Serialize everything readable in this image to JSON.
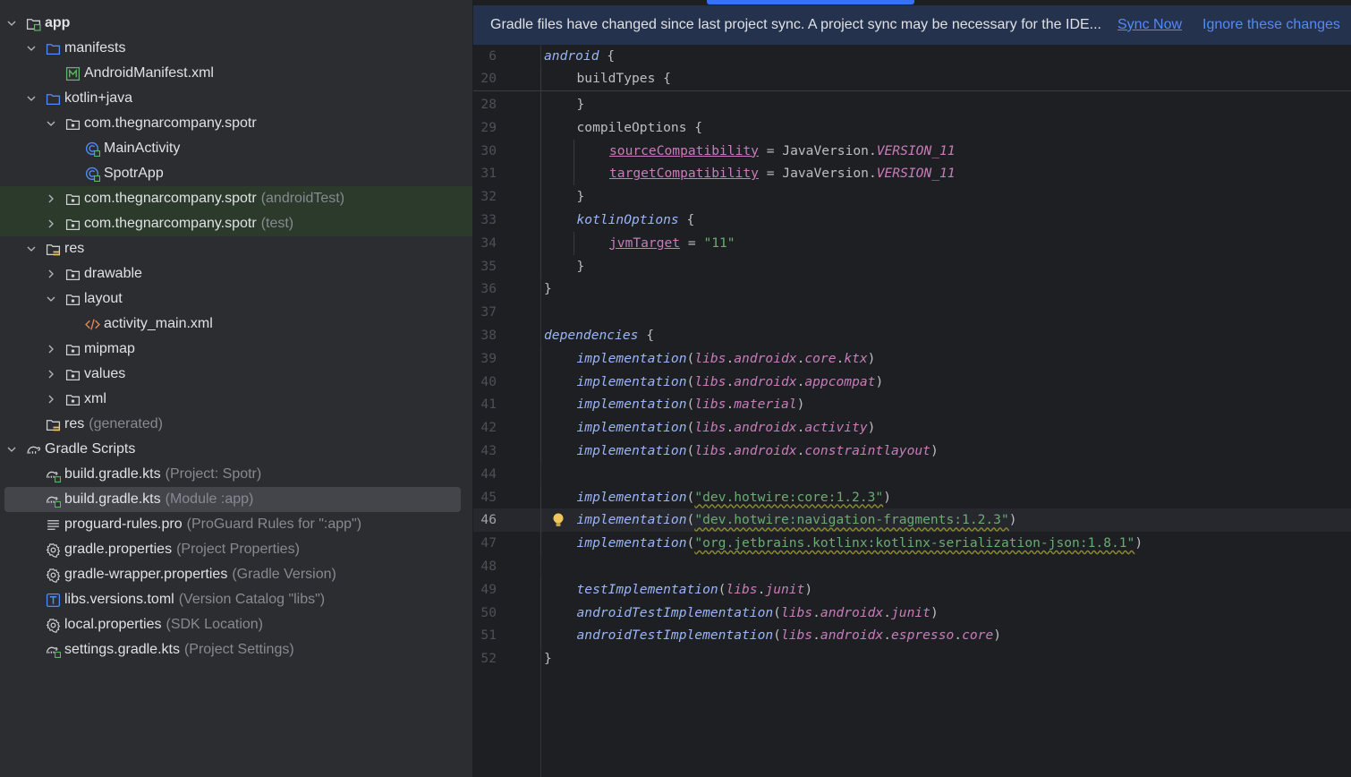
{
  "tree": [
    {
      "label": "app",
      "bold": true,
      "depth": 0,
      "chev": "down",
      "icon": "module-folder"
    },
    {
      "label": "manifests",
      "depth": 1,
      "chev": "down",
      "icon": "folder"
    },
    {
      "label": "AndroidManifest.xml",
      "depth": 2,
      "chev": "none",
      "icon": "manifest"
    },
    {
      "label": "kotlin+java",
      "depth": 1,
      "chev": "down",
      "icon": "folder"
    },
    {
      "label": "com.thegnarcompany.spotr",
      "depth": 2,
      "chev": "down",
      "icon": "package"
    },
    {
      "label": "MainActivity",
      "depth": 3,
      "chev": "none",
      "icon": "activity-class"
    },
    {
      "label": "SpotrApp",
      "depth": 3,
      "chev": "none",
      "icon": "activity-class"
    },
    {
      "label": "com.thegnarcompany.spotr",
      "hint": "(androidTest)",
      "depth": 2,
      "chev": "right",
      "icon": "package",
      "test": true
    },
    {
      "label": "com.thegnarcompany.spotr",
      "hint": "(test)",
      "depth": 2,
      "chev": "right",
      "icon": "package",
      "test": true
    },
    {
      "label": "res",
      "depth": 1,
      "chev": "down",
      "icon": "res-folder"
    },
    {
      "label": "drawable",
      "depth": 2,
      "chev": "right",
      "icon": "package"
    },
    {
      "label": "layout",
      "depth": 2,
      "chev": "down",
      "icon": "package"
    },
    {
      "label": "activity_main.xml",
      "depth": 3,
      "chev": "none",
      "icon": "xml"
    },
    {
      "label": "mipmap",
      "depth": 2,
      "chev": "right",
      "icon": "package"
    },
    {
      "label": "values",
      "depth": 2,
      "chev": "right",
      "icon": "package"
    },
    {
      "label": "xml",
      "depth": 2,
      "chev": "right",
      "icon": "package"
    },
    {
      "label": "res",
      "hint": "(generated)",
      "depth": 1,
      "chev": "none",
      "icon": "res-folder"
    },
    {
      "label": "Gradle Scripts",
      "depth": 0,
      "chev": "down",
      "icon": "gradle"
    },
    {
      "label": "build.gradle.kts",
      "hint": "(Project: Spotr)",
      "depth": 1,
      "chev": "none",
      "icon": "gradle-file"
    },
    {
      "label": "build.gradle.kts",
      "hint": "(Module :app)",
      "depth": 1,
      "chev": "none",
      "icon": "gradle-file",
      "selected": true
    },
    {
      "label": "proguard-rules.pro",
      "hint": "(ProGuard Rules for \":app\")",
      "depth": 1,
      "chev": "none",
      "icon": "text-file"
    },
    {
      "label": "gradle.properties",
      "hint": "(Project Properties)",
      "depth": 1,
      "chev": "none",
      "icon": "gear"
    },
    {
      "label": "gradle-wrapper.properties",
      "hint": "(Gradle Version)",
      "depth": 1,
      "chev": "none",
      "icon": "gear"
    },
    {
      "label": "libs.versions.toml",
      "hint": "(Version Catalog \"libs\")",
      "depth": 1,
      "chev": "none",
      "icon": "toml"
    },
    {
      "label": "local.properties",
      "hint": "(SDK Location)",
      "depth": 1,
      "chev": "none",
      "icon": "gear"
    },
    {
      "label": "settings.gradle.kts",
      "hint": "(Project Settings)",
      "depth": 1,
      "chev": "none",
      "icon": "gradle-file"
    }
  ],
  "banner": {
    "message": "Gradle files have changed since last project sync. A project sync may be necessary for the IDE...",
    "sync_now": "Sync Now",
    "ignore": "Ignore these changes"
  },
  "code": [
    {
      "n": "6",
      "t": [
        [
          "kw",
          "android"
        ],
        [
          "plain",
          " {"
        ]
      ]
    },
    {
      "n": "20",
      "i": 1,
      "t": [
        [
          "plain",
          "buildTypes {"
        ]
      ]
    },
    {
      "n": "28",
      "i": 1,
      "t": [
        [
          "plain",
          "}"
        ]
      ]
    },
    {
      "n": "29",
      "i": 1,
      "t": [
        [
          "plain",
          "compileOptions {"
        ]
      ]
    },
    {
      "n": "30",
      "i": 2,
      "t": [
        [
          "prop",
          "sourceCompatibility"
        ],
        [
          "plain",
          " = JavaVersion."
        ],
        [
          "pur",
          "VERSION_11"
        ]
      ]
    },
    {
      "n": "31",
      "i": 2,
      "t": [
        [
          "prop",
          "targetCompatibility"
        ],
        [
          "plain",
          " = JavaVersion."
        ],
        [
          "pur",
          "VERSION_11"
        ]
      ]
    },
    {
      "n": "32",
      "i": 1,
      "t": [
        [
          "plain",
          "}"
        ]
      ]
    },
    {
      "n": "33",
      "i": 1,
      "t": [
        [
          "kw",
          "kotlinOptions"
        ],
        [
          "plain",
          " {"
        ]
      ]
    },
    {
      "n": "34",
      "i": 2,
      "t": [
        [
          "prop",
          "jvmTarget"
        ],
        [
          "plain",
          " = "
        ],
        [
          "str",
          "\"11\""
        ]
      ]
    },
    {
      "n": "35",
      "i": 1,
      "t": [
        [
          "plain",
          "}"
        ]
      ]
    },
    {
      "n": "36",
      "t": [
        [
          "plain",
          "}"
        ]
      ]
    },
    {
      "n": "37",
      "t": []
    },
    {
      "n": "38",
      "t": [
        [
          "kw",
          "dependencies"
        ],
        [
          "plain",
          " {"
        ]
      ]
    },
    {
      "n": "39",
      "i": 1,
      "t": [
        [
          "kw",
          "implementation"
        ],
        [
          "plain",
          "("
        ],
        [
          "lib",
          "libs"
        ],
        [
          "plain",
          "."
        ],
        [
          "lib",
          "androidx"
        ],
        [
          "plain",
          "."
        ],
        [
          "lib",
          "core"
        ],
        [
          "plain",
          "."
        ],
        [
          "lib",
          "ktx"
        ],
        [
          "plain",
          ")"
        ]
      ]
    },
    {
      "n": "40",
      "i": 1,
      "t": [
        [
          "kw",
          "implementation"
        ],
        [
          "plain",
          "("
        ],
        [
          "lib",
          "libs"
        ],
        [
          "plain",
          "."
        ],
        [
          "lib",
          "androidx"
        ],
        [
          "plain",
          "."
        ],
        [
          "lib",
          "appcompat"
        ],
        [
          "plain",
          ")"
        ]
      ]
    },
    {
      "n": "41",
      "i": 1,
      "t": [
        [
          "kw",
          "implementation"
        ],
        [
          "plain",
          "("
        ],
        [
          "lib",
          "libs"
        ],
        [
          "plain",
          "."
        ],
        [
          "lib",
          "material"
        ],
        [
          "plain",
          ")"
        ]
      ]
    },
    {
      "n": "42",
      "i": 1,
      "t": [
        [
          "kw",
          "implementation"
        ],
        [
          "plain",
          "("
        ],
        [
          "lib",
          "libs"
        ],
        [
          "plain",
          "."
        ],
        [
          "lib",
          "androidx"
        ],
        [
          "plain",
          "."
        ],
        [
          "lib",
          "activity"
        ],
        [
          "plain",
          ")"
        ]
      ]
    },
    {
      "n": "43",
      "i": 1,
      "t": [
        [
          "kw",
          "implementation"
        ],
        [
          "plain",
          "("
        ],
        [
          "lib",
          "libs"
        ],
        [
          "plain",
          "."
        ],
        [
          "lib",
          "androidx"
        ],
        [
          "plain",
          "."
        ],
        [
          "lib",
          "constraintlayout"
        ],
        [
          "plain",
          ")"
        ]
      ]
    },
    {
      "n": "44",
      "t": []
    },
    {
      "n": "45",
      "i": 1,
      "t": [
        [
          "kw",
          "implementation"
        ],
        [
          "plain",
          "("
        ],
        [
          "strw",
          "\"dev.hotwire:core:1.2.3\""
        ],
        [
          "plain",
          ")"
        ]
      ]
    },
    {
      "n": "46",
      "i": 1,
      "cur": true,
      "bulb": true,
      "t": [
        [
          "kw",
          "implementation"
        ],
        [
          "plain",
          "("
        ],
        [
          "strw",
          "\"dev.hotwire:navigation-fragments:1.2.3\""
        ],
        [
          "plain",
          ")"
        ]
      ]
    },
    {
      "n": "47",
      "i": 1,
      "t": [
        [
          "kw",
          "implementation"
        ],
        [
          "plain",
          "("
        ],
        [
          "strw",
          "\"org.jetbrains.kotlinx:kotlinx-serialization-json:1.8.1\""
        ],
        [
          "plain",
          ")"
        ]
      ]
    },
    {
      "n": "48",
      "t": []
    },
    {
      "n": "49",
      "i": 1,
      "t": [
        [
          "kw",
          "testImplementation"
        ],
        [
          "plain",
          "("
        ],
        [
          "lib",
          "libs"
        ],
        [
          "plain",
          "."
        ],
        [
          "lib",
          "junit"
        ],
        [
          "plain",
          ")"
        ]
      ]
    },
    {
      "n": "50",
      "i": 1,
      "t": [
        [
          "kw",
          "androidTestImplementation"
        ],
        [
          "plain",
          "("
        ],
        [
          "lib",
          "libs"
        ],
        [
          "plain",
          "."
        ],
        [
          "lib",
          "androidx"
        ],
        [
          "plain",
          "."
        ],
        [
          "lib",
          "junit"
        ],
        [
          "plain",
          ")"
        ]
      ]
    },
    {
      "n": "51",
      "i": 1,
      "t": [
        [
          "kw",
          "androidTestImplementation"
        ],
        [
          "plain",
          "("
        ],
        [
          "lib",
          "libs"
        ],
        [
          "plain",
          "."
        ],
        [
          "lib",
          "androidx"
        ],
        [
          "plain",
          "."
        ],
        [
          "lib",
          "espresso"
        ],
        [
          "plain",
          "."
        ],
        [
          "lib",
          "core"
        ],
        [
          "plain",
          ")"
        ]
      ]
    },
    {
      "n": "52",
      "t": [
        [
          "plain",
          "}"
        ]
      ]
    }
  ],
  "colors": {
    "accent": "#3574f0",
    "link": "#548af7",
    "banner_bg": "#25324d",
    "tree_bg": "#2b2d30",
    "editor_bg": "#1e1f22"
  }
}
